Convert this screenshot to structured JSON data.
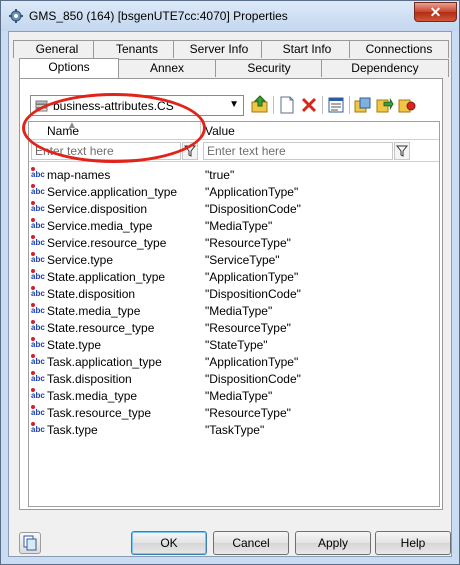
{
  "window": {
    "title": "GMS_850 (164) [bsgenUTE7cc:4070] Properties",
    "close_label": "✕"
  },
  "tabs": {
    "row1": [
      "General",
      "Tenants",
      "Server Info",
      "Start Info",
      "Connections"
    ],
    "row2": [
      "Options",
      "Annex",
      "Security",
      "Dependency"
    ],
    "active": "Options"
  },
  "toolbar": {
    "section_combo": "business-attributes.CS",
    "icons": [
      "up-folder-icon",
      "new-document-icon",
      "delete-icon",
      "properties-icon",
      "copy-icon",
      "export-icon",
      "import-icon"
    ]
  },
  "grid": {
    "columns": [
      "Name",
      "Value"
    ],
    "filter_placeholder": "Enter text here",
    "rows": [
      {
        "name": "map-names",
        "value": "\"true\""
      },
      {
        "name": "Service.application_type",
        "value": "\"ApplicationType\""
      },
      {
        "name": "Service.disposition",
        "value": "\"DispositionCode\""
      },
      {
        "name": "Service.media_type",
        "value": "\"MediaType\""
      },
      {
        "name": "Service.resource_type",
        "value": "\"ResourceType\""
      },
      {
        "name": "Service.type",
        "value": "\"ServiceType\""
      },
      {
        "name": "State.application_type",
        "value": "\"ApplicationType\""
      },
      {
        "name": "State.disposition",
        "value": "\"DispositionCode\""
      },
      {
        "name": "State.media_type",
        "value": "\"MediaType\""
      },
      {
        "name": "State.resource_type",
        "value": "\"ResourceType\""
      },
      {
        "name": "State.type",
        "value": "\"StateType\""
      },
      {
        "name": "Task.application_type",
        "value": "\"ApplicationType\""
      },
      {
        "name": "Task.disposition",
        "value": "\"DispositionCode\""
      },
      {
        "name": "Task.media_type",
        "value": "\"MediaType\""
      },
      {
        "name": "Task.resource_type",
        "value": "\"ResourceType\""
      },
      {
        "name": "Task.type",
        "value": "\"TaskType\""
      }
    ],
    "type_badge": "abc"
  },
  "buttons": {
    "ok": "OK",
    "cancel": "Cancel",
    "apply": "Apply",
    "help": "Help"
  },
  "colors": {
    "annotation": "#e2231a",
    "frame": "#c9dcf2",
    "close": "#c7432b"
  }
}
